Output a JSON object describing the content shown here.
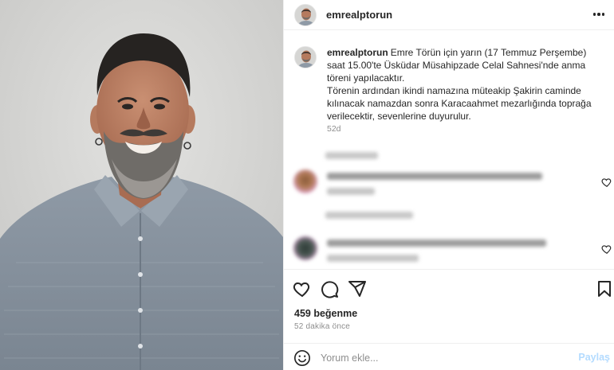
{
  "post": {
    "username": "emrealptorun",
    "caption_lines": [
      "Emre Törün için yarın (17 Temmuz Perşembe) saat 15.00'te Üsküdar Müsahipzade Celal Sahnesi'nde anma töreni yapılacaktır.",
      "Törenin ardından ikindi namazına müteakip Şakirin caminde kılınacak namazdan sonra Karacaahmet mezarlığında toprağa verilecektir, sevenlerine duyurulur."
    ],
    "caption_age": "52d"
  },
  "engagement": {
    "likes": "459 beğenme",
    "time_ago": "52 dakika önce"
  },
  "comment_form": {
    "placeholder": "Yorum ekle...",
    "post_label": "Paylaş"
  },
  "icons": {
    "more": "more-horizontal-icon",
    "like": "heart-icon",
    "comment": "comment-icon",
    "share": "send-icon",
    "save": "bookmark-icon",
    "emoji": "emoji-icon"
  },
  "colors": {
    "text": "#262626",
    "muted": "#8e8e8e",
    "post_button_disabled": "#b3dbff",
    "divider": "#efefef"
  }
}
